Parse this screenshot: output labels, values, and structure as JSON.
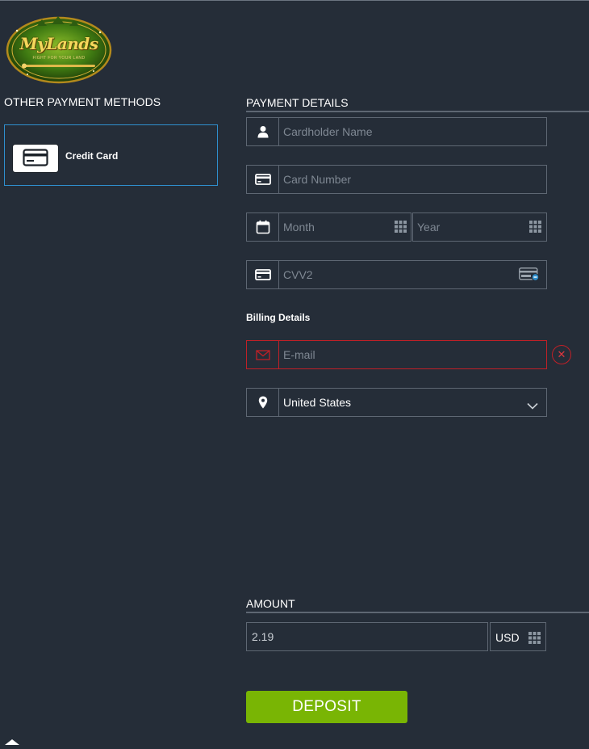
{
  "brand": {
    "logo_text": "MyLands",
    "logo_tagline": "FIGHT FOR YOUR LAND"
  },
  "left": {
    "title": "OTHER PAYMENT METHODS",
    "methods": [
      {
        "label": "Credit Card",
        "icon": "credit-card-icon",
        "selected": true
      }
    ]
  },
  "payment": {
    "title": "PAYMENT DETAILS",
    "cardholder_placeholder": "Cardholder Name",
    "card_number_placeholder": "Card Number",
    "month_placeholder": "Month",
    "year_placeholder": "Year",
    "cvv_placeholder": "CVV2"
  },
  "billing": {
    "title": "Billing Details",
    "email_placeholder": "E-mail",
    "email_error": true,
    "country": "United States"
  },
  "amount": {
    "title": "AMOUNT",
    "value": "2.19",
    "currency": "USD"
  },
  "actions": {
    "deposit_label": "DEPOSIT"
  },
  "colors": {
    "background": "#252d38",
    "border": "#5e6773",
    "selected_border": "#2f8fce",
    "error": "#c02027",
    "deposit_button": "#79b504"
  }
}
